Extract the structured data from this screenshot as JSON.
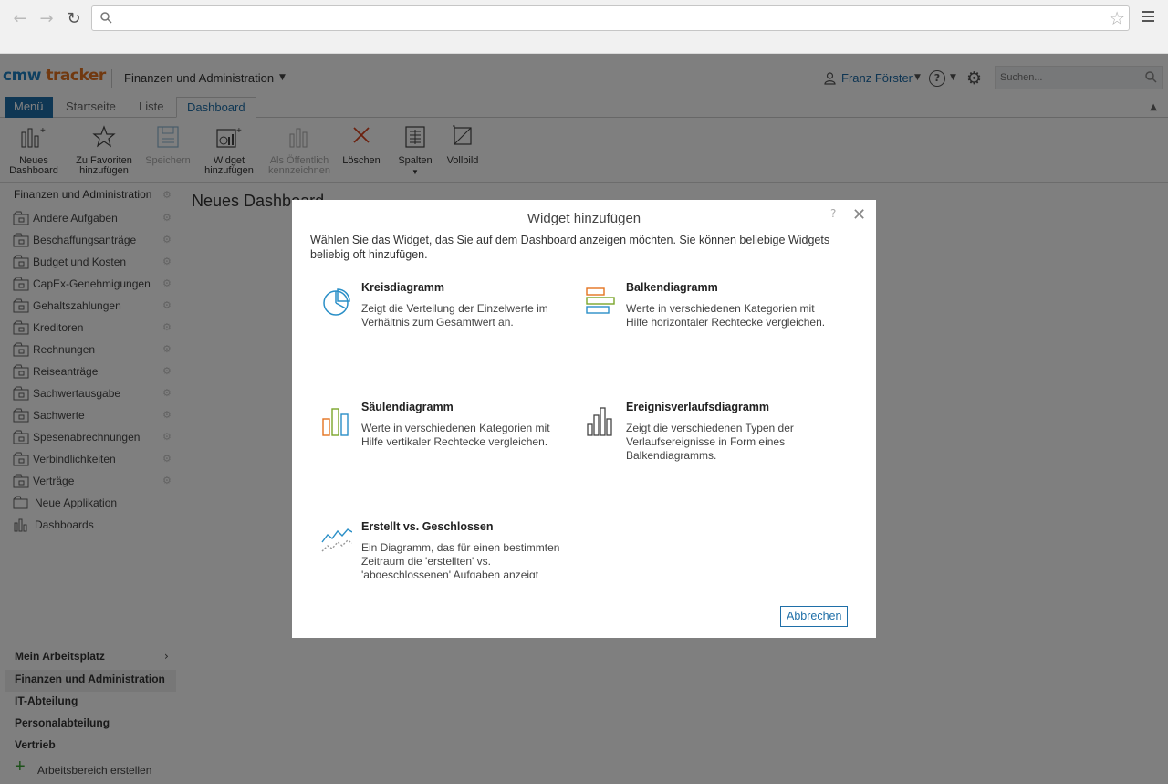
{
  "browser": {
    "url": ""
  },
  "app": {
    "logo_cmw": "cmw",
    "logo_tracker": "tracker",
    "workspace_title": "Finanzen und Administration",
    "user_name": "Franz Förster",
    "help_glyph": "?",
    "search_placeholder": "Suchen..."
  },
  "tabs": [
    {
      "label": "Menü"
    },
    {
      "label": "Startseite"
    },
    {
      "label": "Liste"
    },
    {
      "label": "Dashboard"
    }
  ],
  "toolbar": [
    {
      "line1": "Neues",
      "line2": "Dashboard",
      "icon": "new-dashboard-icon"
    },
    {
      "line1": "Zu Favoriten",
      "line2": "hinzufügen",
      "icon": "star-icon"
    },
    {
      "line1": "Speichern",
      "line2": "",
      "icon": "save-icon"
    },
    {
      "line1": "Widget",
      "line2": "hinzufügen",
      "icon": "add-widget-icon"
    },
    {
      "line1": "Als Öffentlich",
      "line2": "kennzeichnen",
      "icon": "public-icon"
    },
    {
      "line1": "Löschen",
      "line2": "",
      "icon": "delete-icon"
    },
    {
      "line1": "Spalten",
      "line2": "",
      "icon": "columns-icon"
    },
    {
      "line1": "Vollbild",
      "line2": "",
      "icon": "fullscreen-icon"
    }
  ],
  "sidebar": {
    "header": "Finanzen und Administration",
    "items": [
      {
        "label": "Andere Aufgaben"
      },
      {
        "label": "Beschaffungsanträge"
      },
      {
        "label": "Budget und Kosten"
      },
      {
        "label": "CapEx-Genehmigungen"
      },
      {
        "label": "Gehaltszahlungen"
      },
      {
        "label": "Kreditoren"
      },
      {
        "label": "Rechnungen"
      },
      {
        "label": "Reiseanträge"
      },
      {
        "label": "Sachwertausgabe"
      },
      {
        "label": "Sachwerte"
      },
      {
        "label": "Spesenabrechnungen"
      },
      {
        "label": "Verbindlichkeiten"
      },
      {
        "label": "Verträge"
      }
    ],
    "new_app": "Neue Applikation",
    "dashboards": "Dashboards",
    "workspaces": [
      {
        "label": "Mein Arbeitsplatz"
      },
      {
        "label": "Finanzen und Administration"
      },
      {
        "label": "IT-Abteilung"
      },
      {
        "label": "Personalabteilung"
      },
      {
        "label": "Vertrieb"
      }
    ],
    "create_workspace": "Arbeitsbereich erstellen"
  },
  "page": {
    "title": "Neues Dashboard"
  },
  "dialog": {
    "title": "Widget hinzufügen",
    "help": "?",
    "intro": "Wählen Sie das Widget, das Sie auf dem Dashboard anzeigen möchten. Sie können beliebige Widgets beliebig oft hinzufügen.",
    "widgets": [
      {
        "title": "Kreisdiagramm",
        "desc": "Zeigt die Verteilung der Einzelwerte im Verhältnis zum Gesamtwert an.",
        "icon": "pie-chart-icon"
      },
      {
        "title": "Balkendiagramm",
        "desc": "Werte in verschiedenen Kategorien mit Hilfe horizontaler Rechtecke vergleichen.",
        "icon": "bar-chart-icon"
      },
      {
        "title": "Säulendiagramm",
        "desc": "Werte in verschiedenen Kategorien mit Hilfe vertikaler Rechtecke vergleichen.",
        "icon": "column-chart-icon"
      },
      {
        "title": "Ereignisverlaufsdiagramm",
        "desc": "Zeigt die verschiedenen Typen der Verlaufsereignisse in Form eines Balkendiagramms.",
        "icon": "event-history-chart-icon"
      },
      {
        "title": "Erstellt vs. Geschlossen",
        "desc": "Ein Diagramm, das für einen bestimmten Zeitraum die 'erstellten' vs. 'abgeschlossenen' Aufgaben anzeigt",
        "icon": "created-vs-closed-icon"
      }
    ],
    "cancel_label": "Abbrechen"
  }
}
